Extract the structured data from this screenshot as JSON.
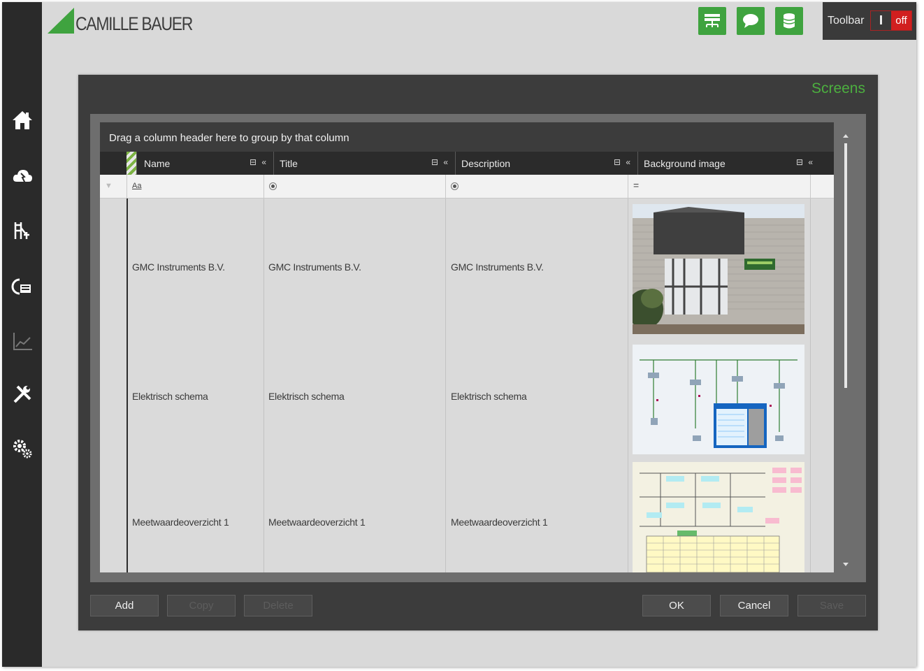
{
  "app": {
    "brand": "CAMILLE BAUER"
  },
  "sidebar": {
    "items": [
      {
        "icon": "home-icon"
      },
      {
        "icon": "cloud-icon"
      },
      {
        "icon": "topology-icon"
      },
      {
        "icon": "device-icon"
      },
      {
        "icon": "chart-icon"
      },
      {
        "icon": "tools-icon"
      },
      {
        "icon": "settings-icon"
      }
    ]
  },
  "topbar": {
    "buttons": [
      {
        "icon": "network-icon"
      },
      {
        "icon": "chat-icon"
      },
      {
        "icon": "database-icon"
      }
    ],
    "toolbar_label": "Toolbar",
    "toggle_on": "I",
    "toggle_off": "off"
  },
  "dialog": {
    "title": "Screens",
    "group_hint": "Drag a column header here to group by that column",
    "columns": [
      "Name",
      "Title",
      "Description",
      "Background image"
    ],
    "filter": {
      "name_operator": "Aa",
      "bg_operator": "="
    },
    "rows": [
      {
        "name": "GMC Instruments B.V.",
        "title": "GMC Instruments B.V.",
        "description": "GMC Instruments B.V."
      },
      {
        "name": "Elektrisch schema",
        "title": "Elektrisch schema",
        "description": "Elektrisch schema"
      },
      {
        "name": "Meetwaardeoverzicht 1",
        "title": "Meetwaardeoverzicht 1",
        "description": "Meetwaardeoverzicht 1"
      }
    ],
    "buttons": {
      "add": "Add",
      "copy": "Copy",
      "delete": "Delete",
      "ok": "OK",
      "cancel": "Cancel",
      "save": "Save"
    }
  },
  "colors": {
    "accent": "#3fa33f",
    "dialog_bg": "#3c3c3c",
    "sidebar_bg": "#2a2a2a",
    "toggle_off": "#d11f1f"
  }
}
